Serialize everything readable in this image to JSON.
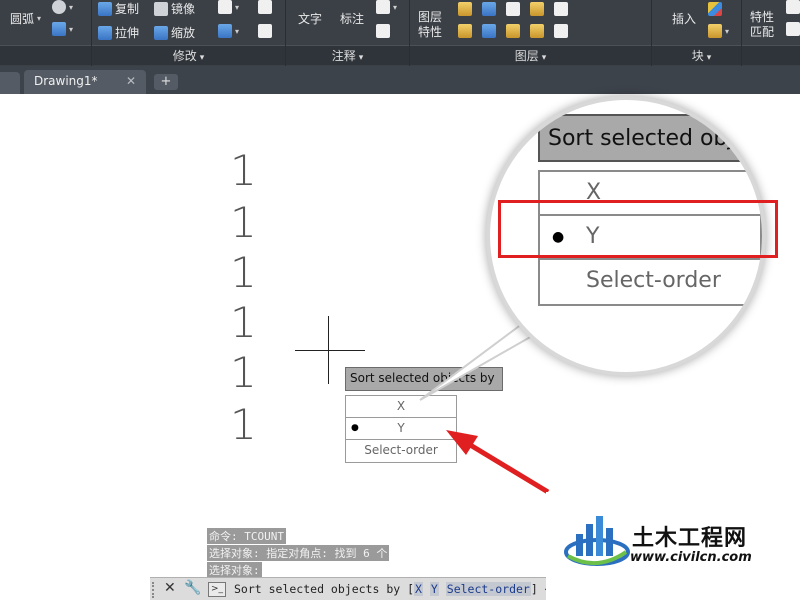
{
  "ribbon": {
    "groups": [
      {
        "label": "",
        "buttons": [
          {
            "label": "圆弧"
          }
        ]
      },
      {
        "label": "修改",
        "buttons": [
          {
            "label": "复制"
          },
          {
            "label": "镜像"
          },
          {
            "label": "拉伸"
          },
          {
            "label": "缩放"
          }
        ]
      },
      {
        "label": "注释",
        "buttons": [
          {
            "label": "文字"
          },
          {
            "label": "标注"
          }
        ]
      },
      {
        "label": "图层",
        "buttons": [
          {
            "label": "图层\n特性"
          }
        ]
      },
      {
        "label": "块",
        "buttons": [
          {
            "label": "插入"
          }
        ]
      },
      {
        "label": "",
        "buttons": [
          {
            "label": "特性\n匹配"
          }
        ]
      }
    ]
  },
  "tabs": {
    "active": "Drawing1*",
    "close": "✕",
    "add": "+"
  },
  "drawing": {
    "digits": [
      "1",
      "1",
      "1",
      "1",
      "1",
      "1"
    ]
  },
  "dynamic_menu": {
    "title": "Sort selected objects by",
    "options": [
      {
        "label": "X",
        "selected": false
      },
      {
        "label": "Y",
        "selected": true
      },
      {
        "label": "Select-order",
        "selected": false
      }
    ]
  },
  "magnifier": {
    "title": "Sort selected obj",
    "options": [
      {
        "label": "X",
        "selected": false
      },
      {
        "label": "Y",
        "selected": true
      },
      {
        "label": "Select-order",
        "selected": false
      }
    ],
    "highlight_color": "#e02020"
  },
  "command_history": [
    "命令: TCOUNT",
    "选择对象: 指定对角点: 找到 6 个",
    "选择对象:"
  ],
  "command_line": {
    "prefix": "Sort selected objects by [",
    "options": [
      "X",
      "Y",
      "Select-order"
    ],
    "suffix": "] <"
  },
  "watermark": {
    "title": "土木工程网",
    "url": "www.civilcn.com"
  },
  "colors": {
    "ribbon_bg": "#3b4047",
    "accent_red": "#e02020"
  }
}
